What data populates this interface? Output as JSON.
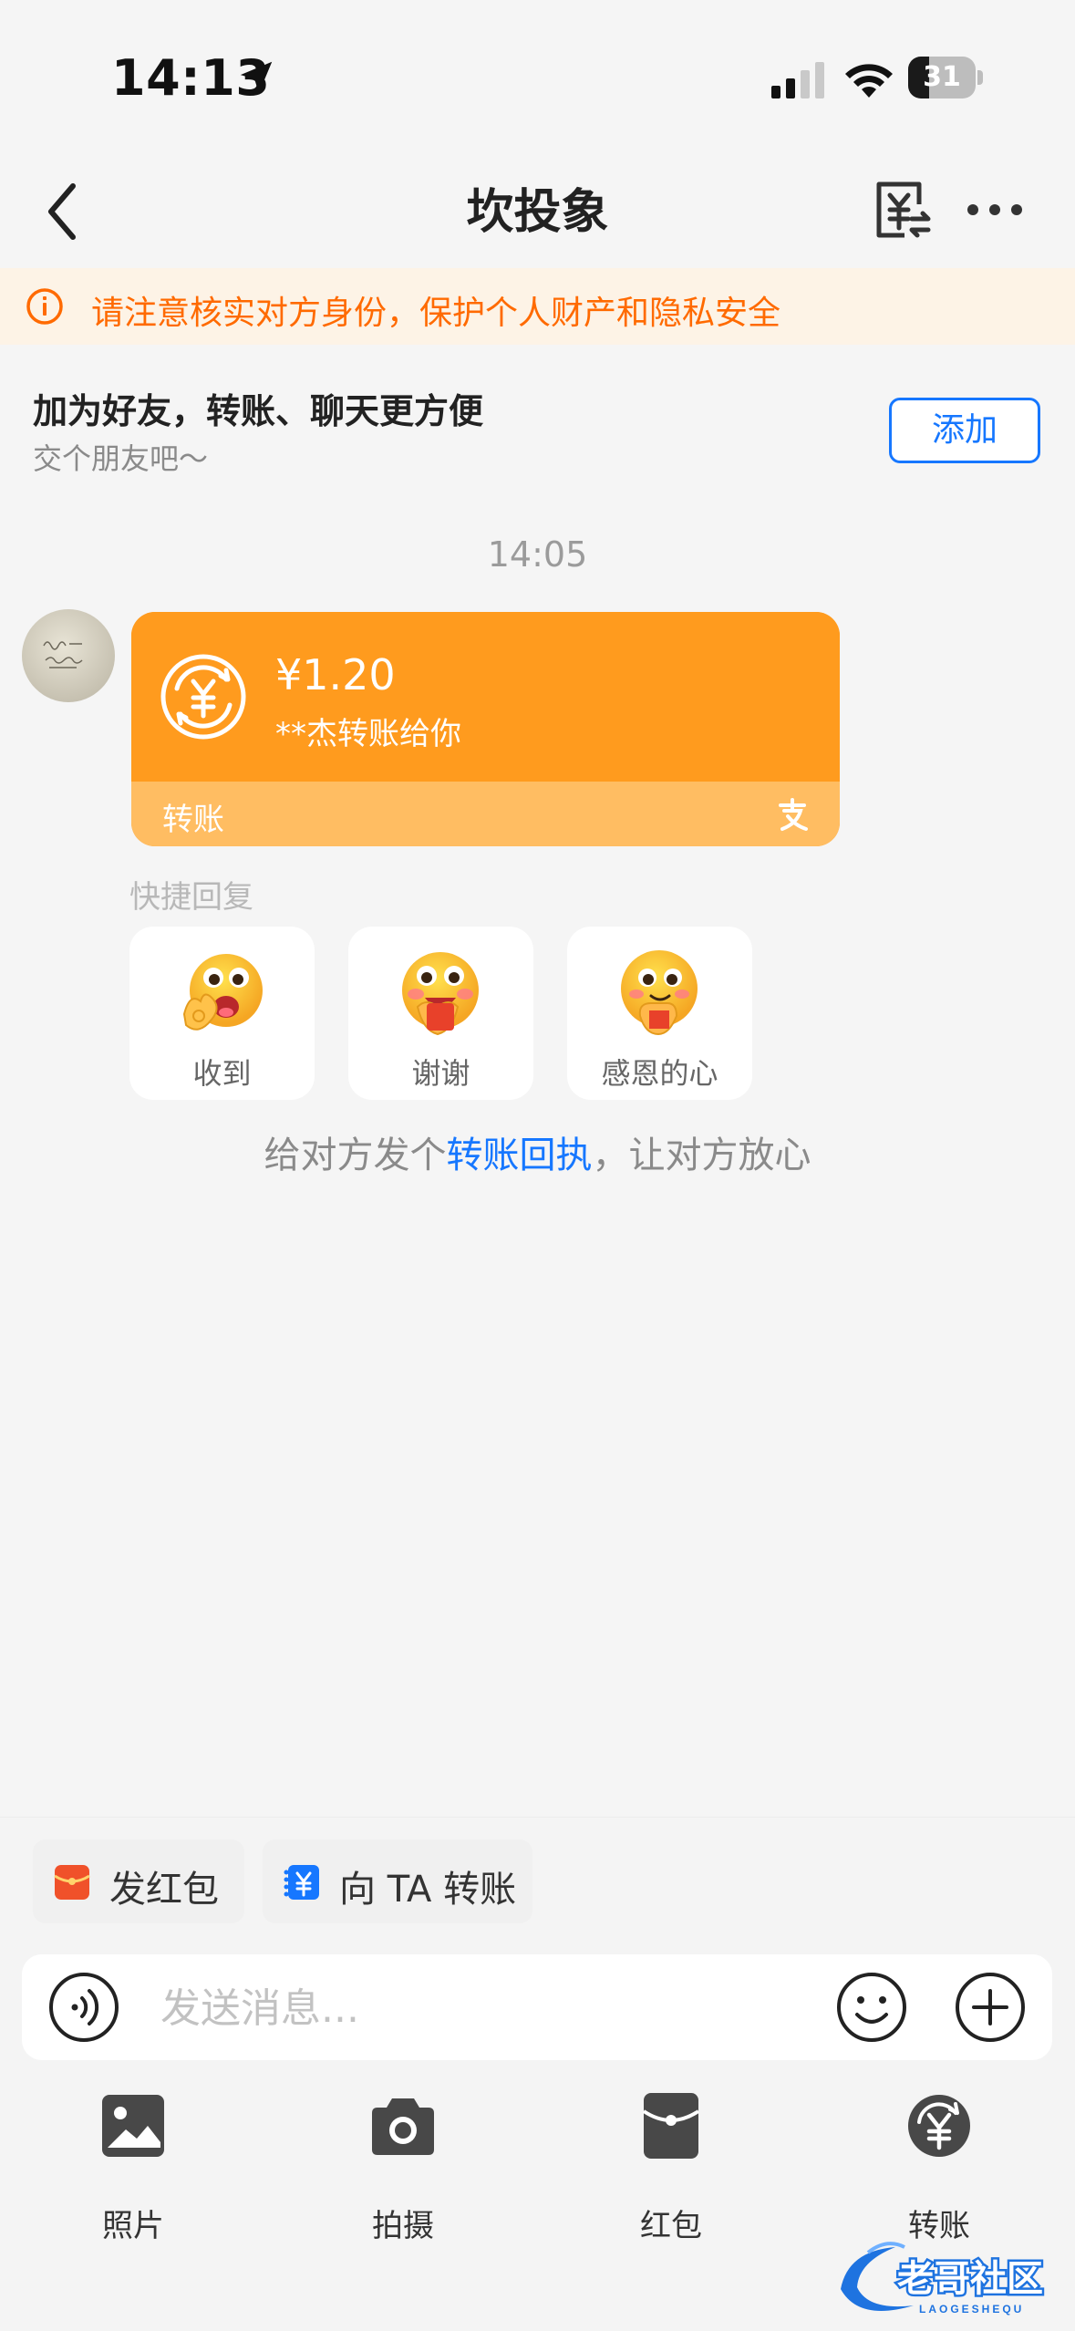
{
  "status_bar": {
    "time": "14:13",
    "battery_level": "31",
    "icons": [
      "location-arrow-icon",
      "cellular-signal-icon",
      "wifi-icon",
      "battery-icon"
    ]
  },
  "nav": {
    "title": "坎投象",
    "icons": [
      "back-chevron-icon",
      "bill-exchange-icon",
      "more-dots-icon"
    ]
  },
  "notice": {
    "text": "请注意核实对方身份，保护个人财产和隐私安全",
    "color": "#ff6a00"
  },
  "friend_banner": {
    "title": "加为好友，转账、聊天更方便",
    "subtitle": "交个朋友吧～",
    "add_label": "添加"
  },
  "chat": {
    "timestamp": "14:05",
    "transfer": {
      "amount": "¥1.20",
      "description": "**杰转账给你",
      "label": "转账",
      "accent": "#ff9b1e"
    },
    "quick_reply": {
      "title": "快捷回复",
      "items": [
        {
          "label": "收到",
          "icon": "ok-hand-emoji-icon"
        },
        {
          "label": "谢谢",
          "icon": "thanks-emoji-icon"
        },
        {
          "label": "感恩的心",
          "icon": "heart-emoji-icon"
        }
      ]
    },
    "receipt_tip": {
      "prefix": "给对方发个",
      "link": "转账回执",
      "suffix": "，让对方放心"
    }
  },
  "shortcuts": {
    "red_packet": "发红包",
    "transfer_to": "向 TA 转账"
  },
  "input": {
    "placeholder": "发送消息..."
  },
  "toolbar": {
    "items": [
      {
        "label": "照片",
        "icon": "photo-icon"
      },
      {
        "label": "拍摄",
        "icon": "camera-icon"
      },
      {
        "label": "红包",
        "icon": "red-packet-icon"
      },
      {
        "label": "转账",
        "icon": "transfer-icon"
      }
    ]
  },
  "watermark": {
    "text": "老哥社区",
    "subtext": "LAOGESHEQU"
  },
  "colors": {
    "brand_blue": "#1677ff",
    "transfer_orange": "#ff9b1e",
    "red_packet": "#f0512a"
  }
}
